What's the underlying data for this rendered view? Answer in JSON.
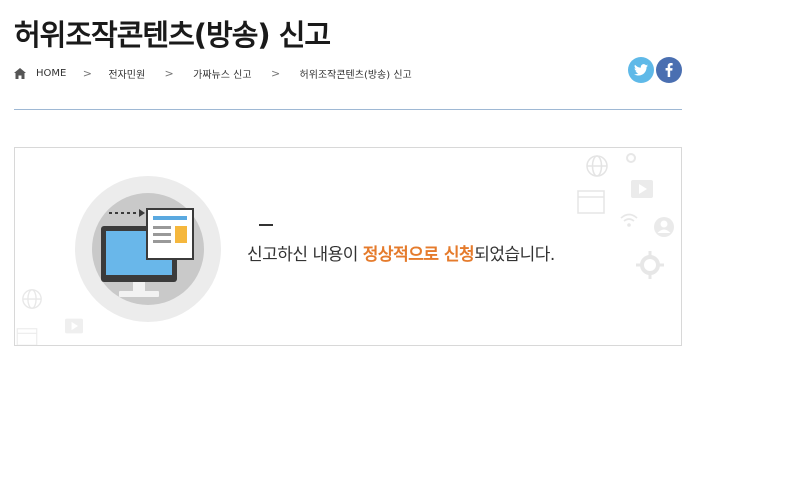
{
  "page": {
    "title": "허위조작콘텐츠(방송) 신고"
  },
  "breadcrumb": {
    "home_icon": "home-icon",
    "items": [
      "HOME",
      "전자민원",
      "가짜뉴스 신고",
      "허위조작콘텐츠(방송) 신고"
    ],
    "separator": ">"
  },
  "share": {
    "twitter_icon": "twitter-icon",
    "facebook_icon": "facebook-icon",
    "twitter_color": "#5fb9e8",
    "facebook_color": "#4a6fb1"
  },
  "result": {
    "illustration_icon": "computer-document-icon",
    "message_before": "신고하신 내용이 ",
    "message_highlight": "정상적으로 신청",
    "message_after": "되었습니다.",
    "highlight_color": "#e57b2c"
  }
}
